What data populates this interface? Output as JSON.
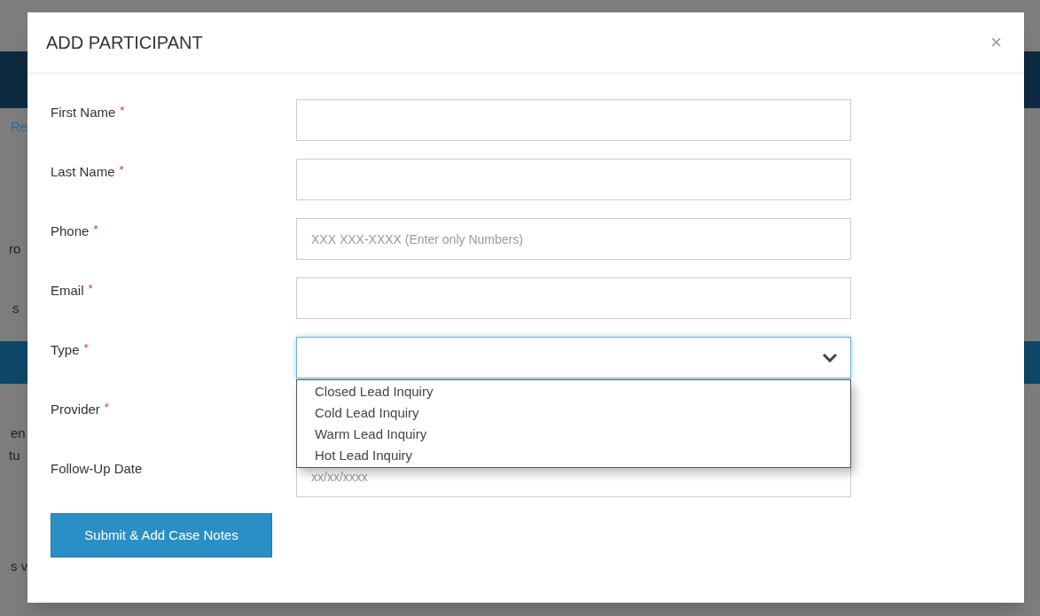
{
  "background": {
    "fragments": [
      "Re",
      "ro",
      "s",
      "en",
      "tu",
      "s v"
    ]
  },
  "dialog": {
    "title": "ADD PARTICIPANT",
    "close": "×",
    "fields": [
      {
        "label": "First Name",
        "required": true,
        "kind": "text"
      },
      {
        "label": "Last Name",
        "required": true,
        "kind": "text"
      },
      {
        "label": "Phone",
        "required": true,
        "kind": "text",
        "placeholder": "XXX XXX-XXXX (Enter only Numbers)"
      },
      {
        "label": "Email",
        "required": true,
        "kind": "text"
      },
      {
        "label": "Type",
        "required": true,
        "kind": "select",
        "focused": true,
        "expanded": true,
        "options": [
          "Closed Lead Inquiry",
          "Cold Lead Inquiry",
          "Warm Lead Inquiry",
          "Hot Lead Inquiry"
        ]
      },
      {
        "label": "Provider",
        "required": true,
        "kind": "hidden"
      },
      {
        "label": "Follow-Up Date",
        "required": false,
        "kind": "text",
        "placeholder": "xx/xx/xxxx"
      }
    ],
    "required_mark": "*",
    "submit": "Submit & Add Case Notes"
  }
}
